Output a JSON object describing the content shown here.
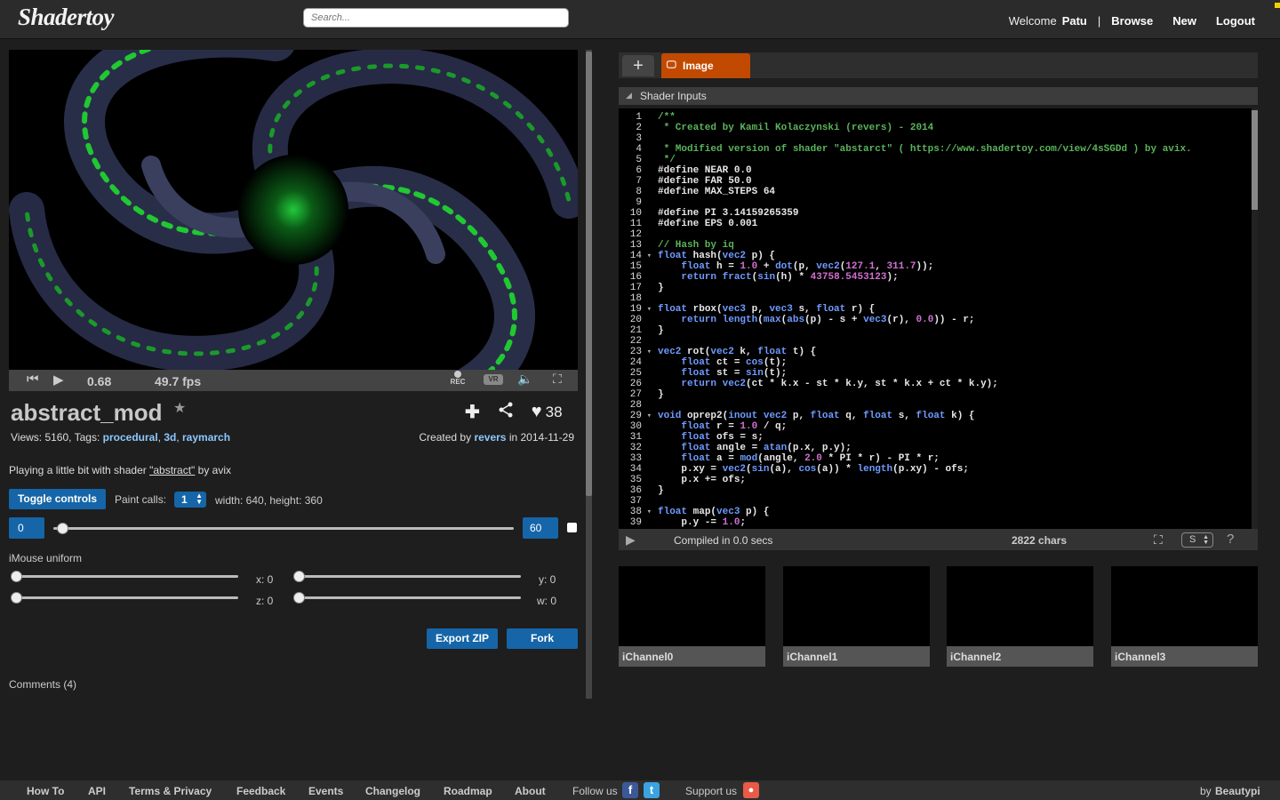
{
  "header": {
    "logo": "Shadertoy",
    "search_placeholder": "Search...",
    "welcome": "Welcome",
    "username": "Patu",
    "separator": "|",
    "browse": "Browse",
    "new": "New",
    "logout": "Logout"
  },
  "player": {
    "time": "0.68",
    "fps": "49.7 fps",
    "rec_label": "REC",
    "vr_label": "VR",
    "icons": [
      "rewind-icon",
      "play-icon",
      "record-icon",
      "vr-icon",
      "volume-icon",
      "fullscreen-icon"
    ]
  },
  "shader": {
    "title": "abstract_mod",
    "likes": "38",
    "views_text": "Views: 5160, Tags:",
    "tags": [
      "procedural",
      "3d",
      "raymarch"
    ],
    "created_by_text": "Created by",
    "author": "revers",
    "date_text": "in 2014-11-29",
    "description_prefix": "Playing a little bit with shader",
    "description_link": "\"abstract\"",
    "description_suffix": "by avix"
  },
  "controls": {
    "toggle_label": "Toggle controls",
    "paint_calls_label": "Paint calls:",
    "paint_calls_value": "1",
    "resolution_text": "width: 640, height: 360",
    "range_min": "0",
    "range_max": "60",
    "time_slider_level": 0.02,
    "imouse_label": "iMouse uniform",
    "x_label": "x: 0",
    "y_label": "y: 0",
    "z_label": "z: 0",
    "w_label": "w: 0",
    "export_label": "Export ZIP",
    "fork_label": "Fork"
  },
  "comments": "Comments (4)",
  "editor": {
    "add_tab": "+",
    "tab_label": "Image",
    "inputs_label": "Shader Inputs",
    "compiled_text": "Compiled in 0.0 secs",
    "chars_text": "2822 chars",
    "font_size_value": "S",
    "help": "?",
    "code_lines": [
      "/**",
      " * Created by Kamil Kolaczynski (revers) - 2014",
      "",
      " * Modified version of shader \"abstarct\" ( https://www.shadertoy.com/view/4sSGDd ) by avix.",
      " */",
      "#define NEAR 0.0",
      "#define FAR 50.0",
      "#define MAX_STEPS 64",
      "",
      "#define PI 3.14159265359",
      "#define EPS 0.001",
      "",
      "// Hash by iq",
      "float hash(vec2 p) {",
      "    float h = 1.0 + dot(p, vec2(127.1, 311.7));",
      "    return fract(sin(h) * 43758.5453123);",
      "}",
      "",
      "float rbox(vec3 p, vec3 s, float r) {",
      "    return length(max(abs(p) - s + vec3(r), 0.0)) - r;",
      "}",
      "",
      "vec2 rot(vec2 k, float t) {",
      "    float ct = cos(t);",
      "    float st = sin(t);",
      "    return vec2(ct * k.x - st * k.y, st * k.x + ct * k.y);",
      "}",
      "",
      "void oprep2(inout vec2 p, float q, float s, float k) {",
      "    float r = 1.0 / q;",
      "    float ofs = s;",
      "    float angle = atan(p.x, p.y);",
      "    float a = mod(angle, 2.0 * PI * r) - PI * r;",
      "    p.xy = vec2(sin(a), cos(a)) * length(p.xy) - ofs;",
      "    p.x += ofs;",
      "}",
      "",
      "float map(vec3 p) {",
      "    p.y -= 1.0;"
    ],
    "fold_lines": [
      14,
      19,
      23,
      29,
      38
    ]
  },
  "channels": [
    "iChannel0",
    "iChannel1",
    "iChannel2",
    "iChannel3"
  ],
  "footer": {
    "links": [
      "How To",
      "API",
      "Terms & Privacy",
      "Feedback",
      "Events",
      "Changelog",
      "Roadmap",
      "About"
    ],
    "follow": "Follow us",
    "support": "Support us",
    "by": "by",
    "credit": "Beautypi"
  },
  "colors": {
    "accent_blue": "#1565a8",
    "tab_orange": "#c24a00",
    "link_blue": "#8cc8ff",
    "comment_green": "#5ab45a",
    "keyword_blue": "#6f9bff",
    "number_magenta": "#d070d0"
  }
}
